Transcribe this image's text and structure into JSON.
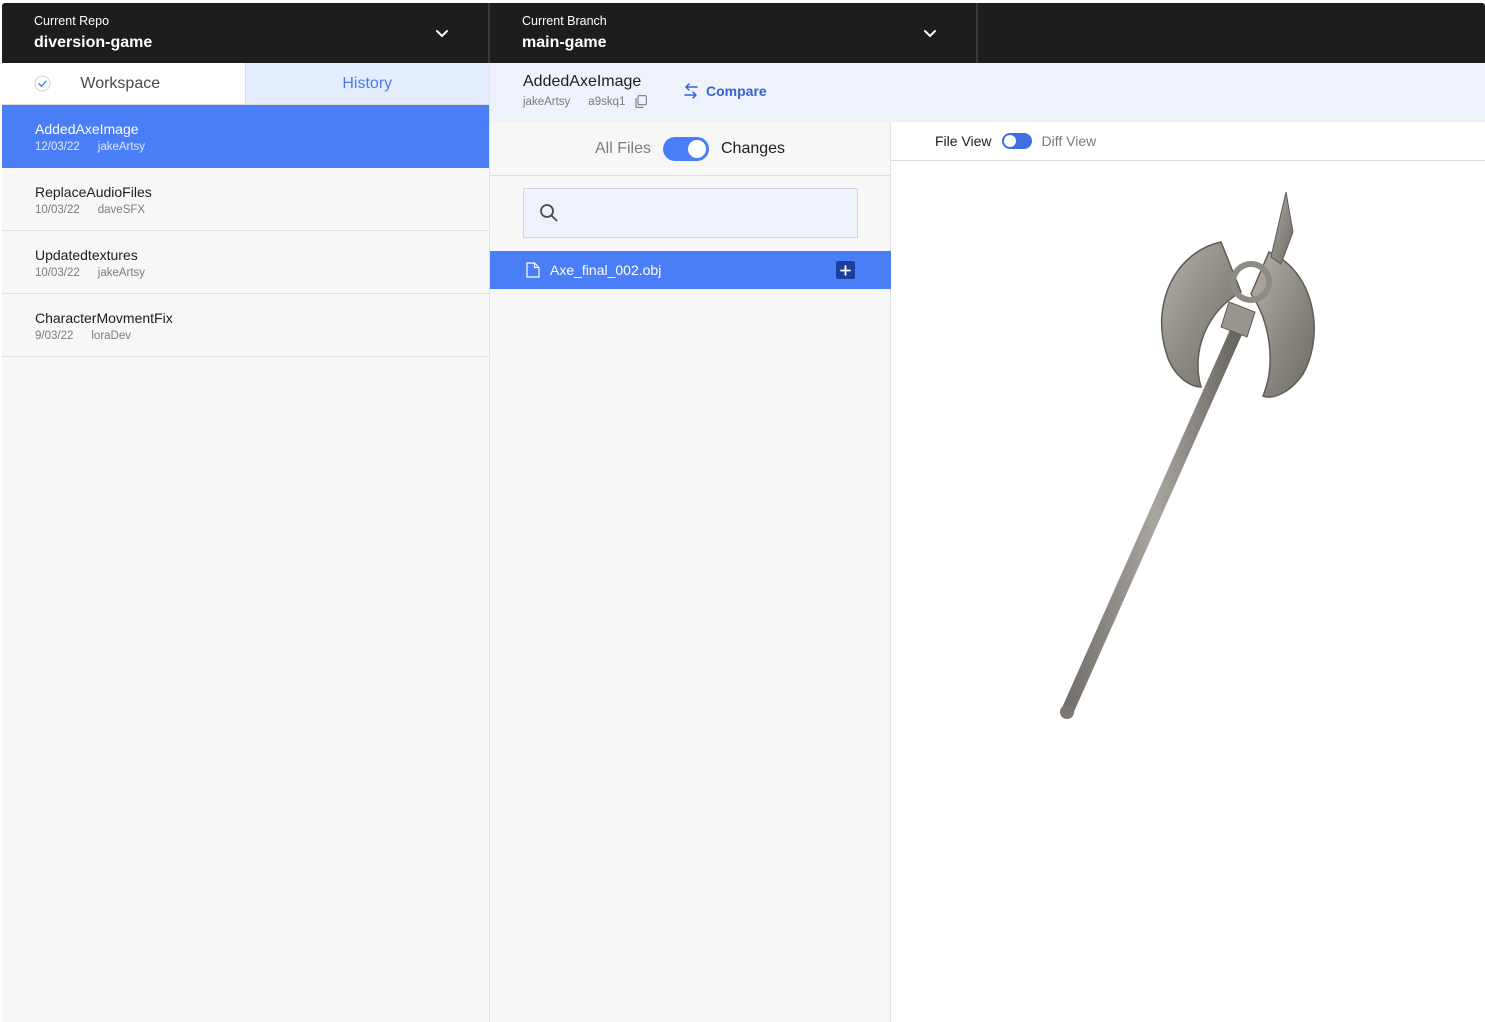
{
  "repo": {
    "label": "Current Repo",
    "value": "diversion-game"
  },
  "branch": {
    "label": "Current Branch",
    "value": "main-game"
  },
  "tabs": {
    "workspace": "Workspace",
    "history": "History"
  },
  "commits": [
    {
      "title": "AddedAxeImage",
      "date": "12/03/22",
      "author": "jakeArtsy",
      "selected": true
    },
    {
      "title": "ReplaceAudioFiles",
      "date": "10/03/22",
      "author": "daveSFX",
      "selected": false
    },
    {
      "title": "Updatedtextures",
      "date": "10/03/22",
      "author": "jakeArtsy",
      "selected": false
    },
    {
      "title": "CharacterMovmentFix",
      "date": "9/03/22",
      "author": "loraDev",
      "selected": false
    }
  ],
  "commit_header": {
    "title": "AddedAxeImage",
    "author": "jakeArtsy",
    "hash": "a9skq1",
    "compare_label": "Compare"
  },
  "filter": {
    "all_files": "All Files",
    "changes": "Changes",
    "changes_only": true
  },
  "search": {
    "placeholder": ""
  },
  "files": [
    {
      "name": "Axe_final_002.obj",
      "status": "added"
    }
  ],
  "view": {
    "file_view": "File View",
    "diff_view": "Diff View",
    "diff_enabled": false
  },
  "colors": {
    "accent": "#4a7ef7",
    "topbar": "#1d1d1f",
    "history_tab_bg": "#e3edfd",
    "compare": "#3562d9"
  }
}
